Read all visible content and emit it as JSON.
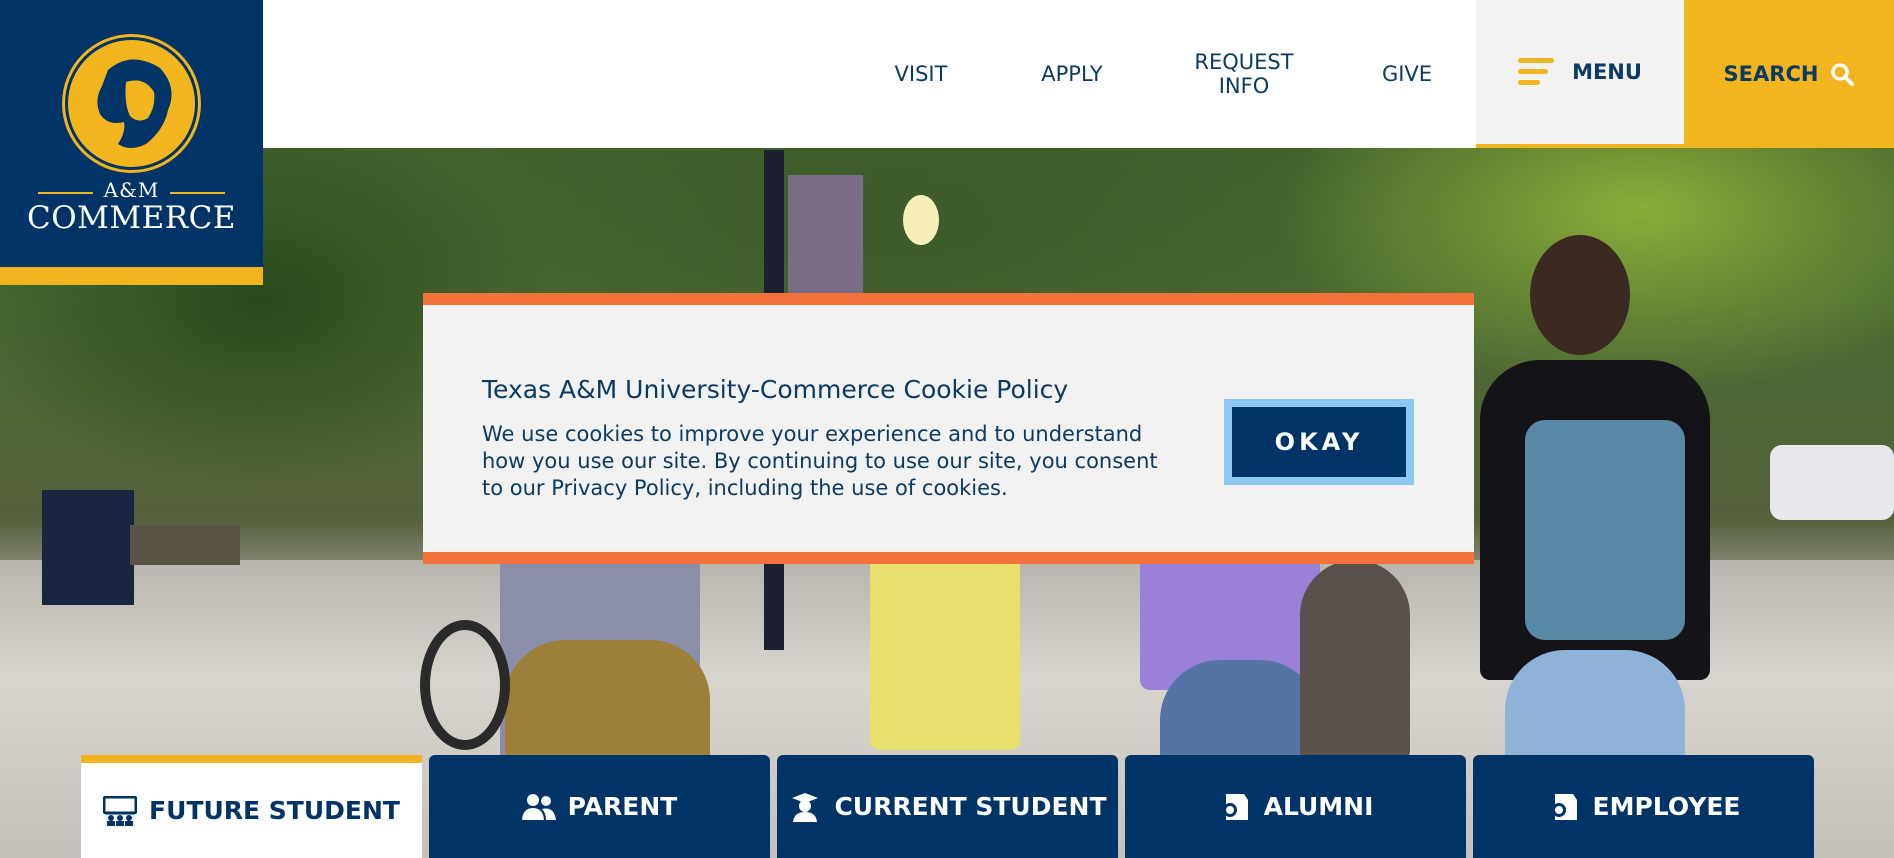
{
  "logo": {
    "line1": "A&M",
    "line2": "COMMERCE",
    "icon": "lion-icon"
  },
  "nav": {
    "visit": "VISIT",
    "apply": "APPLY",
    "request_info_line1": "REQUEST",
    "request_info_line2": "INFO",
    "give": "GIVE",
    "menu": "MENU",
    "search": "SEARCH"
  },
  "cookie": {
    "title": "Texas A&M University-Commerce Cookie Policy",
    "text": "We use cookies to improve your experience and to understand how you use our site. By continuing to use our site, you consent to our Privacy Policy, including the use of cookies.",
    "button": "OKAY"
  },
  "audience_tabs": [
    {
      "label": "FUTURE STUDENT",
      "icon": "classroom-icon",
      "active": true
    },
    {
      "label": "PARENT",
      "icon": "people-icon",
      "active": false
    },
    {
      "label": "CURRENT STUDENT",
      "icon": "graduate-icon",
      "active": false
    },
    {
      "label": "ALUMNI",
      "icon": "diploma-icon",
      "active": false
    },
    {
      "label": "EMPLOYEE",
      "icon": "badge-icon",
      "active": false
    }
  ],
  "colors": {
    "navy": "#003366",
    "gold": "#f2b51e",
    "orange": "#f4713a",
    "light_blue": "#8cc8f2"
  }
}
